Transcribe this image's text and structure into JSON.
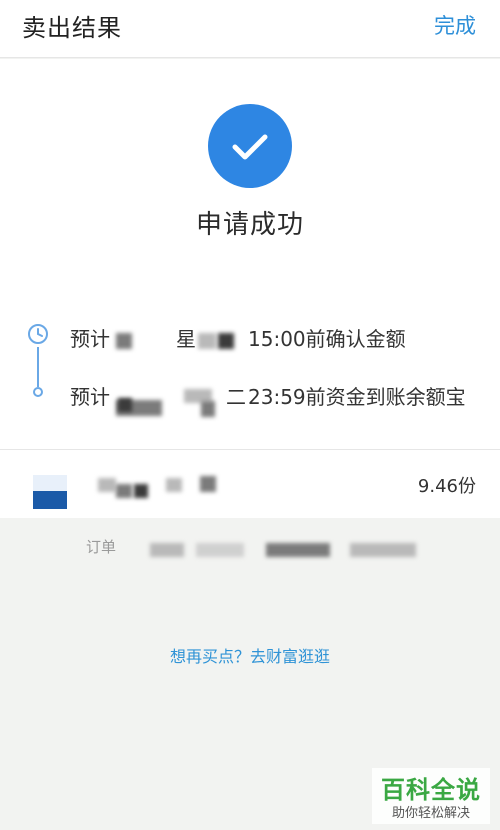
{
  "header": {
    "title": "卖出结果",
    "done_label": "完成"
  },
  "result": {
    "status_text": "申请成功"
  },
  "timeline": {
    "steps": [
      {
        "prefix": "预计",
        "partial": "星",
        "time_text": "15:00前确认金额"
      },
      {
        "prefix": "预计",
        "partial": "二",
        "time_text": "23:59前资金到账余额宝"
      }
    ]
  },
  "fund": {
    "amount": "9.46份"
  },
  "order": {
    "label": "订单"
  },
  "footer": {
    "buy_again_link": "想再买点？去财富逛逛"
  },
  "watermark": {
    "title": "百科全说",
    "subtitle": "助你轻松解决"
  },
  "colors": {
    "accent": "#2d8fd8",
    "success_circle": "#2e86e3",
    "timeline": "#6aa8e6"
  }
}
